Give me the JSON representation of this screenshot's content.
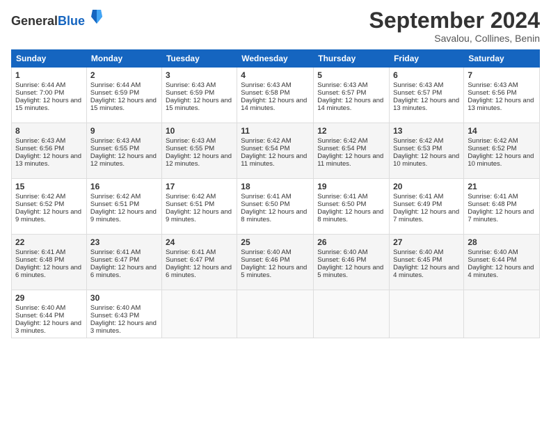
{
  "logo": {
    "general": "General",
    "blue": "Blue"
  },
  "title": "September 2024",
  "location": "Savalou, Collines, Benin",
  "days_of_week": [
    "Sunday",
    "Monday",
    "Tuesday",
    "Wednesday",
    "Thursday",
    "Friday",
    "Saturday"
  ],
  "weeks": [
    [
      {
        "day": "1",
        "sunrise": "6:44 AM",
        "sunset": "7:00 PM",
        "daylight": "12 hours and 15 minutes."
      },
      {
        "day": "2",
        "sunrise": "6:44 AM",
        "sunset": "6:59 PM",
        "daylight": "12 hours and 15 minutes."
      },
      {
        "day": "3",
        "sunrise": "6:43 AM",
        "sunset": "6:59 PM",
        "daylight": "12 hours and 15 minutes."
      },
      {
        "day": "4",
        "sunrise": "6:43 AM",
        "sunset": "6:58 PM",
        "daylight": "12 hours and 14 minutes."
      },
      {
        "day": "5",
        "sunrise": "6:43 AM",
        "sunset": "6:57 PM",
        "daylight": "12 hours and 14 minutes."
      },
      {
        "day": "6",
        "sunrise": "6:43 AM",
        "sunset": "6:57 PM",
        "daylight": "12 hours and 13 minutes."
      },
      {
        "day": "7",
        "sunrise": "6:43 AM",
        "sunset": "6:56 PM",
        "daylight": "12 hours and 13 minutes."
      }
    ],
    [
      {
        "day": "8",
        "sunrise": "6:43 AM",
        "sunset": "6:56 PM",
        "daylight": "12 hours and 13 minutes."
      },
      {
        "day": "9",
        "sunrise": "6:43 AM",
        "sunset": "6:55 PM",
        "daylight": "12 hours and 12 minutes."
      },
      {
        "day": "10",
        "sunrise": "6:43 AM",
        "sunset": "6:55 PM",
        "daylight": "12 hours and 12 minutes."
      },
      {
        "day": "11",
        "sunrise": "6:42 AM",
        "sunset": "6:54 PM",
        "daylight": "12 hours and 11 minutes."
      },
      {
        "day": "12",
        "sunrise": "6:42 AM",
        "sunset": "6:54 PM",
        "daylight": "12 hours and 11 minutes."
      },
      {
        "day": "13",
        "sunrise": "6:42 AM",
        "sunset": "6:53 PM",
        "daylight": "12 hours and 10 minutes."
      },
      {
        "day": "14",
        "sunrise": "6:42 AM",
        "sunset": "6:52 PM",
        "daylight": "12 hours and 10 minutes."
      }
    ],
    [
      {
        "day": "15",
        "sunrise": "6:42 AM",
        "sunset": "6:52 PM",
        "daylight": "12 hours and 9 minutes."
      },
      {
        "day": "16",
        "sunrise": "6:42 AM",
        "sunset": "6:51 PM",
        "daylight": "12 hours and 9 minutes."
      },
      {
        "day": "17",
        "sunrise": "6:42 AM",
        "sunset": "6:51 PM",
        "daylight": "12 hours and 9 minutes."
      },
      {
        "day": "18",
        "sunrise": "6:41 AM",
        "sunset": "6:50 PM",
        "daylight": "12 hours and 8 minutes."
      },
      {
        "day": "19",
        "sunrise": "6:41 AM",
        "sunset": "6:50 PM",
        "daylight": "12 hours and 8 minutes."
      },
      {
        "day": "20",
        "sunrise": "6:41 AM",
        "sunset": "6:49 PM",
        "daylight": "12 hours and 7 minutes."
      },
      {
        "day": "21",
        "sunrise": "6:41 AM",
        "sunset": "6:48 PM",
        "daylight": "12 hours and 7 minutes."
      }
    ],
    [
      {
        "day": "22",
        "sunrise": "6:41 AM",
        "sunset": "6:48 PM",
        "daylight": "12 hours and 6 minutes."
      },
      {
        "day": "23",
        "sunrise": "6:41 AM",
        "sunset": "6:47 PM",
        "daylight": "12 hours and 6 minutes."
      },
      {
        "day": "24",
        "sunrise": "6:41 AM",
        "sunset": "6:47 PM",
        "daylight": "12 hours and 6 minutes."
      },
      {
        "day": "25",
        "sunrise": "6:40 AM",
        "sunset": "6:46 PM",
        "daylight": "12 hours and 5 minutes."
      },
      {
        "day": "26",
        "sunrise": "6:40 AM",
        "sunset": "6:46 PM",
        "daylight": "12 hours and 5 minutes."
      },
      {
        "day": "27",
        "sunrise": "6:40 AM",
        "sunset": "6:45 PM",
        "daylight": "12 hours and 4 minutes."
      },
      {
        "day": "28",
        "sunrise": "6:40 AM",
        "sunset": "6:44 PM",
        "daylight": "12 hours and 4 minutes."
      }
    ],
    [
      {
        "day": "29",
        "sunrise": "6:40 AM",
        "sunset": "6:44 PM",
        "daylight": "12 hours and 3 minutes."
      },
      {
        "day": "30",
        "sunrise": "6:40 AM",
        "sunset": "6:43 PM",
        "daylight": "12 hours and 3 minutes."
      },
      null,
      null,
      null,
      null,
      null
    ]
  ]
}
